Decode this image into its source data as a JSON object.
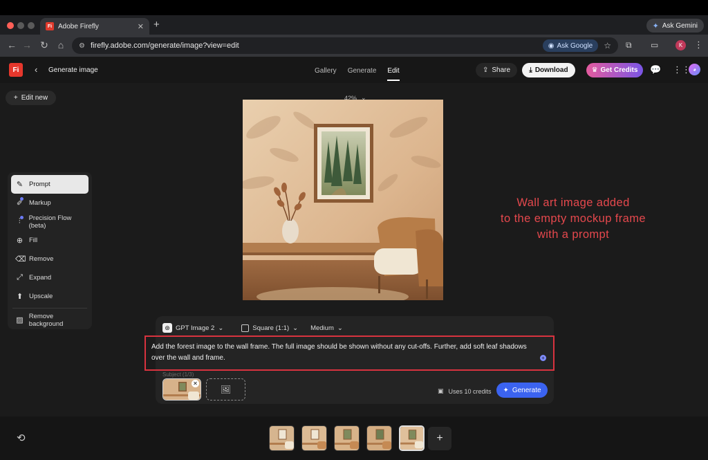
{
  "browser": {
    "tab_title": "Adobe Firefly",
    "url": "firefly.adobe.com/generate/image?view=edit",
    "ask_google": "Ask Google",
    "ask_gemini": "Ask Gemini",
    "profile_initial": "K"
  },
  "header": {
    "logo": "Fi",
    "title": "Generate image",
    "tabs": [
      "Gallery",
      "Generate",
      "Edit"
    ],
    "active_tab": "Edit",
    "share": "Share",
    "download": "Download",
    "get_credits": "Get Credits"
  },
  "sidebar": {
    "edit_new": "Edit new",
    "tools": [
      {
        "label": "Prompt",
        "icon": "prompt-icon",
        "active": true
      },
      {
        "label": "Markup",
        "icon": "markup-icon"
      },
      {
        "label": "Precision Flow (beta)",
        "icon": "precision-flow-icon"
      },
      {
        "label": "Fill",
        "icon": "fill-icon"
      },
      {
        "label": "Remove",
        "icon": "remove-icon"
      },
      {
        "label": "Expand",
        "icon": "expand-icon"
      },
      {
        "label": "Upscale",
        "icon": "upscale-icon"
      },
      {
        "label": "Remove background",
        "icon": "remove-background-icon"
      }
    ]
  },
  "canvas": {
    "zoom": "42%"
  },
  "annotation": {
    "lines": [
      "Wall art image added",
      "to the empty mockup frame",
      "with a prompt"
    ]
  },
  "prompt_panel": {
    "model": "GPT Image 2",
    "aspect": "Square (1:1)",
    "quality": "Medium",
    "prompt_text": "Add the forest image to the wall frame. The full image should be shown without any cut-offs. Further, add soft leaf shadows over the wall and frame.",
    "subject_label": "Subject (1/3)",
    "credits": "Uses 10 credits",
    "generate": "Generate"
  },
  "colors": {
    "annotation": "#e5484d",
    "prompt_border": "#d9333f",
    "generate": "#3b63f0",
    "logo": "#e6372c"
  }
}
